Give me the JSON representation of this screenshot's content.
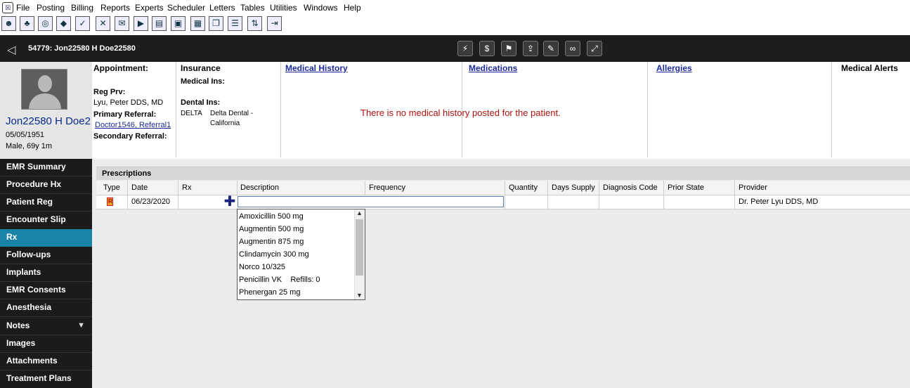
{
  "menubar": {
    "items": [
      "File",
      "Posting",
      "Billing",
      "Reports",
      "Experts",
      "Scheduler",
      "Letters",
      "Tables",
      "Utilities",
      "Windows",
      "Help"
    ]
  },
  "toolbar": {
    "icons": [
      "patients-icon",
      "family-icon",
      "search-icon",
      "ledger-icon",
      "checklist-icon",
      "treatment-icon",
      "letter-icon",
      "insurance-icon",
      "notes-icon",
      "image-icon",
      "schedule-icon",
      "windows-icon",
      "list-icon",
      "transfer-icon",
      "exit-icon"
    ]
  },
  "patient_bar": {
    "title": "54779: Jon22580 H Doe22580",
    "actions": [
      "lightning-icon",
      "dollar-icon",
      "flag-icon",
      "export-icon",
      "signature-icon",
      "link-icon",
      "expand-icon"
    ]
  },
  "patient": {
    "name": "Jon22580 H Doe2",
    "dob": "05/05/1951",
    "sex_age": "Male, 69y 1m"
  },
  "appointment": {
    "heading": "Appointment:",
    "reg_prv_label": "Reg Prv:",
    "reg_prv_value": "Lyu, Peter DDS, MD",
    "primary_referral_label": "Primary Referral:",
    "primary_referral_value": "Doctor1546, Referral1",
    "secondary_referral_label": "Secondary Referral:"
  },
  "insurance": {
    "heading": "Insurance",
    "medical_label": "Medical Ins:",
    "dental_label": "Dental Ins:",
    "dental_code": "DELTA",
    "dental_name_line1": "Delta Dental -",
    "dental_name_line2": "California"
  },
  "sections": {
    "medical_history": "Medical History",
    "medications": "Medications",
    "allergies": "Allergies",
    "medical_alerts": "Medical Alerts",
    "no_history_message": "There is no medical history posted for the patient."
  },
  "nav": {
    "items": [
      "EMR Summary",
      "Procedure Hx",
      "Patient Reg",
      "Encounter Slip",
      "Rx",
      "Follow-ups",
      "Implants",
      "EMR Consents",
      "Anesthesia",
      "Notes",
      "Images",
      "Attachments",
      "Treatment Plans"
    ],
    "active": "Rx"
  },
  "prescriptions": {
    "title": "Prescriptions",
    "columns": [
      "Type",
      "Date",
      "Rx",
      "Description",
      "Frequency",
      "Quantity",
      "Days Supply",
      "Diagnosis Code",
      "Prior State",
      "Provider"
    ],
    "row": {
      "date": "06/23/2020",
      "description": "",
      "provider": "Dr. Peter Lyu DDS, MD"
    },
    "dropdown_options": [
      "Amoxicillin 500 mg",
      "Augmentin 500 mg",
      "Augmentin 875 mg",
      "Clindamycin 300 mg",
      "Norco 10/325",
      "Penicillin VK    Refills: 0",
      "Phenergan 25 mg"
    ]
  },
  "colors": {
    "nav_bg": "#1b1b1b",
    "nav_active": "#1a84a8",
    "header_bar": "#1d1d1d",
    "link": "#1a2a9c",
    "alert_text": "#b01010"
  }
}
